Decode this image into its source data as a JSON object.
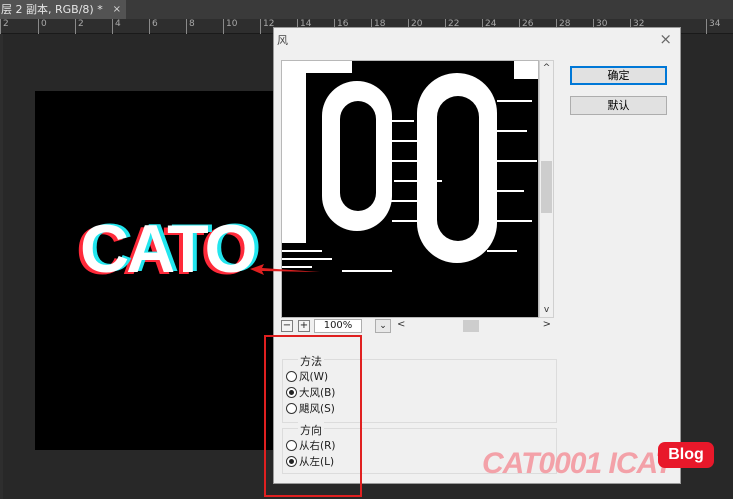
{
  "document": {
    "tab_label": "层 2 副本, RGB/8) *",
    "close_label": "×"
  },
  "ruler": {
    "marks": [
      "2",
      "0",
      "2",
      "4",
      "6",
      "8",
      "10",
      "12",
      "14",
      "16",
      "18",
      "20",
      "22",
      "24",
      "26",
      "28",
      "30",
      "32",
      "34"
    ]
  },
  "canvas": {
    "text": "CATO"
  },
  "dialog": {
    "title": "风",
    "close_label": "×",
    "buttons": {
      "ok": "确定",
      "default": "默认"
    },
    "preview": {
      "zoom_out": "−",
      "zoom_in": "+",
      "zoom_value": "100%",
      "dropdown_arrow": "⌄",
      "scroll_left": "<",
      "scroll_right": ">",
      "scroll_up": "^",
      "scroll_down": "v"
    },
    "method": {
      "label": "方法",
      "options": [
        "风(W)",
        "大风(B)",
        "飓风(S)"
      ],
      "selected": "大风(B)"
    },
    "direction": {
      "label": "方向",
      "options": [
        "从右(R)",
        "从左(L)"
      ],
      "selected": "从左(L)"
    }
  },
  "watermark": {
    "text": "CAT0001 ICAT",
    "badge": "Blog"
  },
  "colors": {
    "annotation_red": "#e02020",
    "watermark_pink": "#f3a1a8",
    "badge_red": "#e8182a"
  }
}
